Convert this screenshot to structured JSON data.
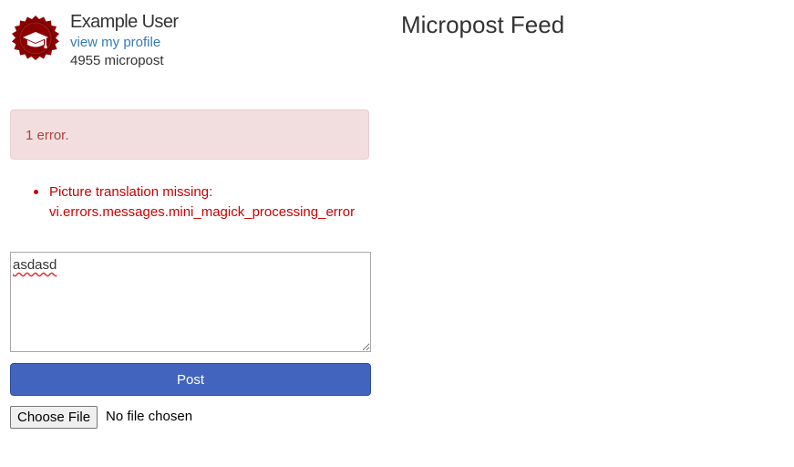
{
  "user": {
    "name": "Example User",
    "profile_link": "view my profile",
    "micropost_count": "4955 micropost",
    "avatar_icon": "graduation-cap-badge-icon",
    "avatar_color": "#8b0000"
  },
  "feed": {
    "title": "Micropost Feed"
  },
  "errors": {
    "summary": "1 error.",
    "items": [
      {
        "line1": "Picture translation missing:",
        "line2": "vi.errors.messages.mini_magick_processing_error"
      }
    ],
    "text_color": "#cc0000",
    "alert_background": "#f2dede"
  },
  "form": {
    "content_value": "asdasd",
    "post_label": "Post",
    "post_button_color": "#4264be",
    "choose_file_label": "Choose File",
    "file_status": "No file chosen"
  }
}
